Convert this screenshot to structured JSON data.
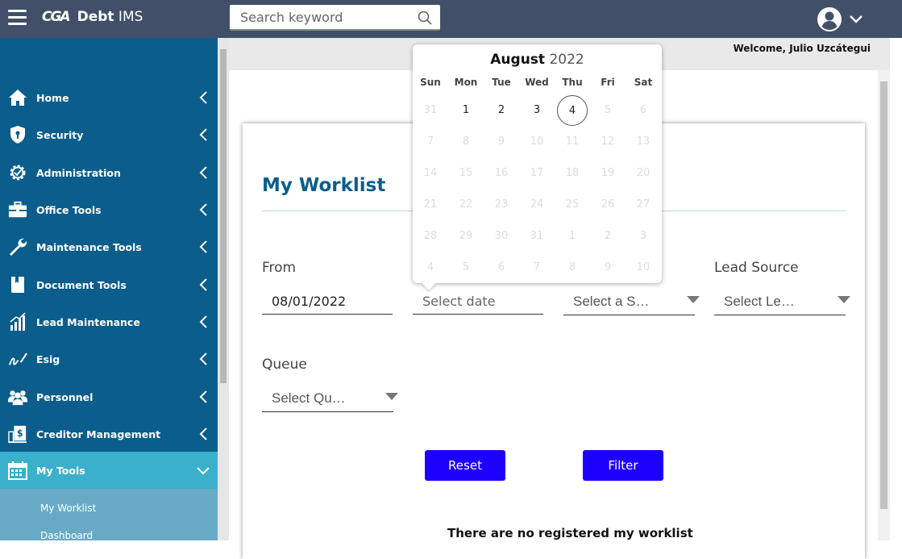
{
  "app": {
    "logo_mark": "CGA",
    "name_bold": "Debt",
    "name_rest": " IMS"
  },
  "search": {
    "placeholder": "Search keyword"
  },
  "welcome": "Welcome, Julio Uzcátegui",
  "sidebar": {
    "items": [
      {
        "label": "Home",
        "icon": "home-icon"
      },
      {
        "label": "Security",
        "icon": "shield-icon"
      },
      {
        "label": "Administration",
        "icon": "gear-check-icon"
      },
      {
        "label": "Office Tools",
        "icon": "toolbox-icon"
      },
      {
        "label": "Maintenance Tools",
        "icon": "wrench-icon"
      },
      {
        "label": "Document Tools",
        "icon": "book-icon"
      },
      {
        "label": "Lead Maintenance",
        "icon": "bar-chart-icon"
      },
      {
        "label": "Esig",
        "icon": "signature-icon"
      },
      {
        "label": "Personnel",
        "icon": "people-icon"
      },
      {
        "label": "Creditor Management",
        "icon": "building-dollar-icon"
      },
      {
        "label": "My Tools",
        "icon": "calendar-icon"
      }
    ],
    "subitems": [
      "My Worklist",
      "Dashboard"
    ]
  },
  "page": {
    "title": "My Worklist",
    "from_label": "From",
    "from_value": "08/01/2022",
    "to_placeholder": "Select date",
    "status_placeholder": "Select a S…",
    "lead_source_label": "Lead Source",
    "lead_source_placeholder": "Select Le…",
    "queue_label": "Queue",
    "queue_placeholder": "Select Qu…",
    "reset_label": "Reset",
    "filter_label": "Filter",
    "empty_message": "There are no registered my worklist"
  },
  "calendar": {
    "month": "August",
    "year": "2022",
    "weekdays": [
      "Sun",
      "Mon",
      "Tue",
      "Wed",
      "Thu",
      "Fri",
      "Sat"
    ],
    "weeks": [
      [
        "31",
        "1",
        "2",
        "3",
        "4",
        "5",
        "6"
      ],
      [
        "7",
        "8",
        "9",
        "10",
        "11",
        "12",
        "13"
      ],
      [
        "14",
        "15",
        "16",
        "17",
        "18",
        "19",
        "20"
      ],
      [
        "21",
        "22",
        "23",
        "24",
        "25",
        "26",
        "27"
      ],
      [
        "28",
        "29",
        "30",
        "31",
        "1",
        "2",
        "3"
      ],
      [
        "4",
        "5",
        "6",
        "7",
        "8",
        "9",
        "10"
      ]
    ],
    "enabled_days": [
      "1",
      "2",
      "3",
      "4"
    ],
    "today": "4"
  },
  "colors": {
    "topbar": "#415068",
    "sidebar": "#0b5d8c",
    "active": "#3ab0cc",
    "button": "#1e00ff",
    "title": "#0b5d8c"
  }
}
